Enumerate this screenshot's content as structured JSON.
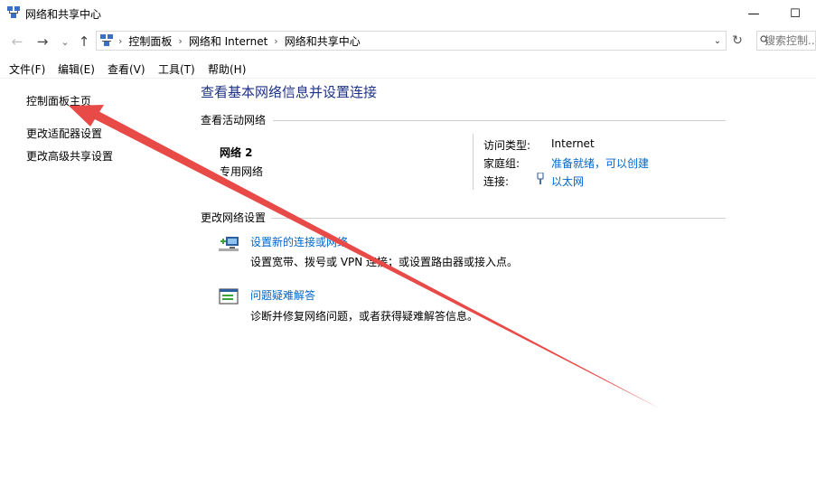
{
  "window": {
    "title": "网络和共享中心",
    "minimize_glyph": "—",
    "maximize_glyph": "☐"
  },
  "nav": {
    "back_glyph": "←",
    "forward_glyph": "→",
    "recent_glyph": "⌄",
    "up_glyph": "↑",
    "breadcrumb": [
      "控制面板",
      "网络和 Internet",
      "网络和共享中心"
    ],
    "breadcrumb_sep": "›",
    "dropdown_glyph": "⌄",
    "refresh_glyph": "↻",
    "search_placeholder": "搜索控制..."
  },
  "menu": [
    "文件(F)",
    "编辑(E)",
    "查看(V)",
    "工具(T)",
    "帮助(H)"
  ],
  "sidebar": {
    "items": [
      "控制面板主页",
      "更改适配器设置",
      "更改高级共享设置"
    ]
  },
  "main": {
    "title": "查看基本网络信息并设置连接",
    "active_networks_header": "查看活动网络",
    "network": {
      "name": "网络 2",
      "category": "专用网络",
      "access_type_label": "访问类型:",
      "access_type_value": "Internet",
      "homegroup_label": "家庭组:",
      "homegroup_value": "准备就绪，可以创建",
      "connections_label": "连接:",
      "connections_value": "以太网"
    },
    "change_settings_header": "更改网络设置",
    "tasks": [
      {
        "link": "设置新的连接或网络",
        "desc": "设置宽带、拨号或 VPN 连接；或设置路由器或接入点。",
        "icon": "new-connection-icon"
      },
      {
        "link": "问题疑难解答",
        "desc": "诊断并修复网络问题，或者获得疑难解答信息。",
        "icon": "troubleshoot-icon"
      }
    ]
  },
  "colors": {
    "link": "#0066cc",
    "title": "#1e3287",
    "annotation_arrow": "#e84a48"
  }
}
